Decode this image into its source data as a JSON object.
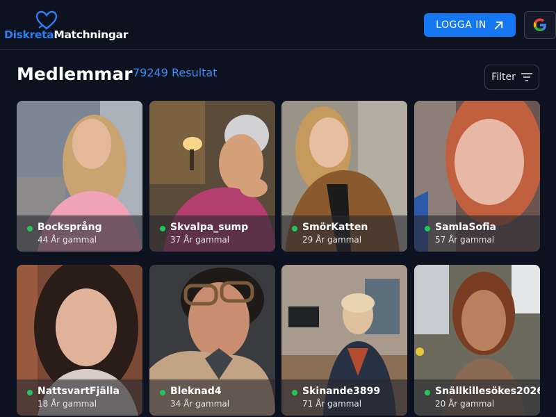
{
  "header": {
    "logo_part1": "Diskreta",
    "logo_part2": "Matchningar",
    "login_label": "LOGGA IN",
    "google_icon": "google-icon"
  },
  "page": {
    "title": "Medlemmar",
    "result_count": "79249 Resultat",
    "filter_label": "Filter"
  },
  "members": [
    {
      "name": "Bocksprång",
      "age": "44 År gammal"
    },
    {
      "name": "Skvalpa_sump",
      "age": "37 År gammal"
    },
    {
      "name": "SmörKatten",
      "age": "29 År gammal"
    },
    {
      "name": "SamlaSofia",
      "age": "57 År gammal"
    },
    {
      "name": "NattsvartFjälla",
      "age": "18 År gammal"
    },
    {
      "name": "Bleknad4",
      "age": "34 År gammal"
    },
    {
      "name": "Skinande3899",
      "age": "71 År gammal"
    },
    {
      "name": "Snällkillesökes2026",
      "age": "20 År gammal"
    }
  ],
  "colors": {
    "background": "#0d1220",
    "accent": "#1677f2",
    "online": "#22c55e"
  }
}
